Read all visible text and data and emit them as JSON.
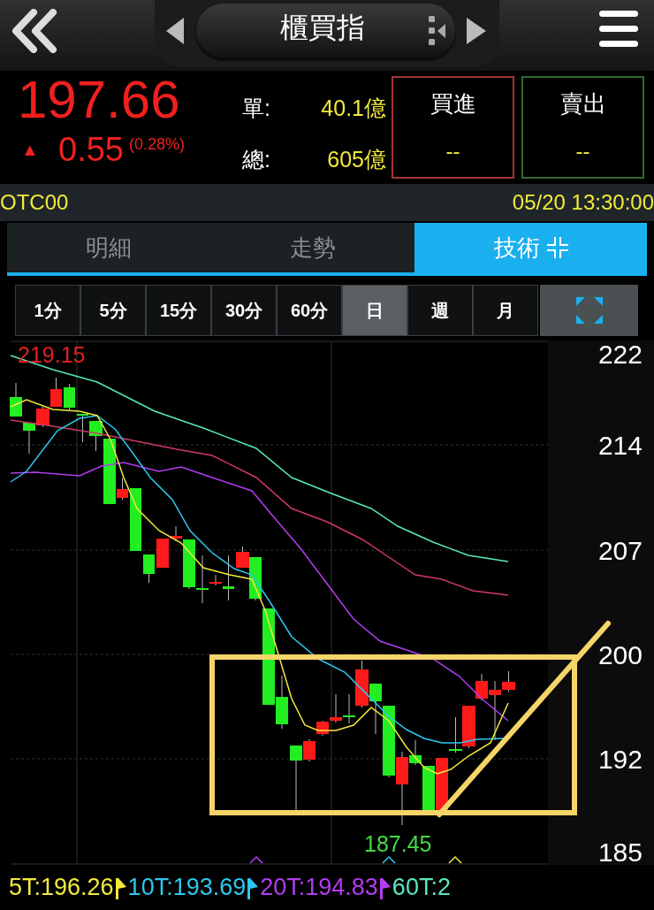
{
  "header": {
    "title": "櫃買指"
  },
  "quote": {
    "price": "197.66",
    "change_arrow": "▲",
    "change": "0.55",
    "change_percent": "(0.28%)",
    "stats": [
      {
        "label": "單:",
        "value": "40.1億"
      },
      {
        "label": "總:",
        "value": "605億"
      }
    ],
    "orders": [
      {
        "kind": "buy",
        "label": "買進",
        "value": "--"
      },
      {
        "kind": "sell",
        "label": "賣出",
        "value": "--"
      }
    ]
  },
  "status_bar": {
    "symbol": "OTC00",
    "datetime": "05/20 13:30:00"
  },
  "tabs": [
    {
      "label": "明細",
      "selected": false
    },
    {
      "label": "走勢",
      "selected": false
    },
    {
      "label": "技術",
      "selected": true
    }
  ],
  "periods": [
    {
      "label": "1分",
      "selected": false
    },
    {
      "label": "5分",
      "selected": false
    },
    {
      "label": "15分",
      "selected": false
    },
    {
      "label": "30分",
      "selected": false
    },
    {
      "label": "60分",
      "selected": false
    },
    {
      "label": "日",
      "selected": true
    },
    {
      "label": "週",
      "selected": false
    },
    {
      "label": "月",
      "selected": false
    }
  ],
  "chart": {
    "high_label": "219.15",
    "low_label": "187.45",
    "y_axis_labels": [
      "222",
      "214",
      "207",
      "200",
      "192",
      "185"
    ],
    "legend": [
      {
        "label": "5T:196.26",
        "color": "#f2ea3c"
      },
      {
        "label": "10T:193.69",
        "color": "#2ec8f0"
      },
      {
        "label": "20T:194.83",
        "color": "#b43cf0"
      },
      {
        "label": "60T:2",
        "color": "#5ae6c0"
      }
    ]
  }
}
